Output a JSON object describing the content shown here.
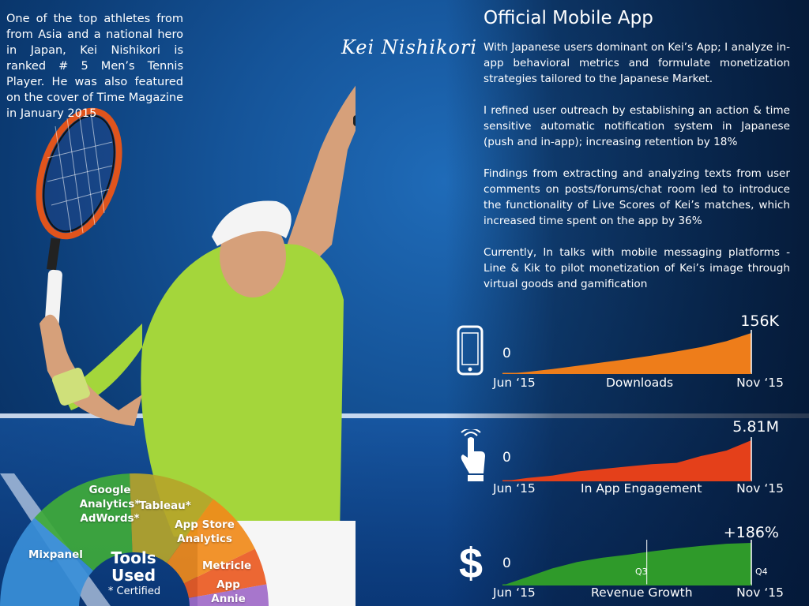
{
  "intro_text": "One of the top athletes from from Asia and a national hero in Japan, Kei Nishikori is ranked # 5 Men’s Tennis Player. He was also featured on the cover of Time Magazine in January 2015",
  "signature": "Kei Nishikori",
  "app": {
    "title": "Official Mobile App",
    "paragraphs": [
      "With Japanese users dominant on Kei’s App; I analyze in-app behavioral metrics and formulate monetization strategies tailored to the Japanese Market.",
      "I refined user outreach by establishing an action & time sensitive automatic notification system in Japanese (push and in-app); increasing retention by 18%",
      "Findings from extracting and analyzing texts from user comments on posts/forums/chat room led to introduce the functionality of Live Scores of Kei’s matches, which increased time spent on the app by 36%",
      "Currently, In talks with mobile messaging platforms - Line & Kik to pilot monetization of Kei’s image through virtual goods and gamification"
    ]
  },
  "metrics": {
    "downloads": {
      "icon": "phone-icon",
      "zero": "0",
      "total": "156K",
      "start": "Jun ‘15",
      "label": "Downloads",
      "end": "Nov ‘15",
      "color": "#ee7d1a"
    },
    "engagement": {
      "icon": "tap-hand-icon",
      "zero": "0",
      "total": "5.81M",
      "start": "Jun ‘15",
      "label": "In App Engagement",
      "end": "Nov ‘15",
      "color": "#e4401a"
    },
    "revenue": {
      "icon": "dollar-icon",
      "zero": "0",
      "total": "+186%",
      "start": "Jun ‘15",
      "label": "Revenue Growth",
      "end": "Nov ‘15",
      "color": "#2f9a2a",
      "q3": "Q3",
      "q4": "Q4"
    }
  },
  "tools": {
    "title": "Tools Used",
    "note": "* Certified",
    "segments": [
      {
        "name": "Mixpanel",
        "color": "#3a8fd8"
      },
      {
        "name": "Google Analytics* AdWords*",
        "color": "#3faa3a"
      },
      {
        "name": "Tableau*",
        "color": "#b5a52a"
      },
      {
        "name": "App Store Analytics",
        "color": "#f08a1a"
      },
      {
        "name": "Metricle",
        "color": "#ea5a22"
      },
      {
        "name": "App Annie",
        "color": "#a06ac8"
      }
    ]
  },
  "chart_data": [
    {
      "type": "area",
      "title": "Downloads",
      "x": [
        "Jun ‘15",
        "Nov ‘15"
      ],
      "series": [
        {
          "name": "Downloads",
          "values": [
            0,
            0.05,
            0.12,
            0.2,
            0.28,
            0.36,
            0.45,
            0.55,
            0.66,
            0.8,
            1.0
          ]
        }
      ],
      "ylim_labels": [
        "0",
        "156K"
      ]
    },
    {
      "type": "area",
      "title": "In App Engagement",
      "x": [
        "Jun ‘15",
        "Nov ‘15"
      ],
      "series": [
        {
          "name": "In App Engagement",
          "values": [
            0,
            0.08,
            0.14,
            0.24,
            0.3,
            0.36,
            0.42,
            0.45,
            0.62,
            0.75,
            1.0
          ]
        }
      ],
      "ylim_labels": [
        "0",
        "5.81M"
      ]
    },
    {
      "type": "area",
      "title": "Revenue Growth",
      "x": [
        "Jun ‘15",
        "Nov ‘15"
      ],
      "series": [
        {
          "name": "Revenue Growth",
          "values": [
            0,
            0.2,
            0.4,
            0.55,
            0.65,
            0.72,
            0.8,
            0.87,
            0.93,
            0.98,
            1.0
          ]
        }
      ],
      "ylim_labels": [
        "0",
        "+186%"
      ]
    }
  ]
}
